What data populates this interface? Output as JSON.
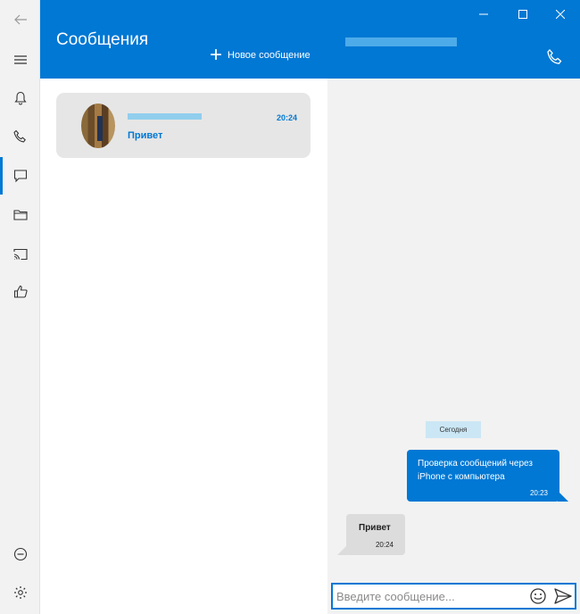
{
  "rail": {
    "items": [
      {
        "icon": "back-arrow-icon"
      },
      {
        "icon": "hamburger-menu-icon"
      },
      {
        "icon": "bell-icon"
      },
      {
        "icon": "phone-icon"
      },
      {
        "icon": "chat-icon",
        "active": true
      },
      {
        "icon": "folder-icon"
      },
      {
        "icon": "cast-icon"
      },
      {
        "icon": "thumbs-up-icon"
      },
      {
        "icon": "minus-circle-icon"
      },
      {
        "icon": "gear-icon"
      }
    ]
  },
  "list": {
    "title": "Сообщения",
    "new_message_label": "Новое сообщение",
    "conversations": [
      {
        "time": "20:24",
        "preview": "Привет"
      }
    ]
  },
  "chat": {
    "day_label": "Сегодня",
    "messages": [
      {
        "direction": "outgoing",
        "text": "Проверка сообщений через iPhone с компьютера",
        "time": "20:23"
      },
      {
        "direction": "incoming",
        "text": "Привет",
        "time": "20:24"
      }
    ],
    "composer_placeholder": "Введите сообщение..."
  },
  "colors": {
    "accent": "#0078d4",
    "panel_bg": "#f2f2f2",
    "incoming_bubble": "#dcdcdc",
    "day_chip": "#cbe7f5"
  }
}
